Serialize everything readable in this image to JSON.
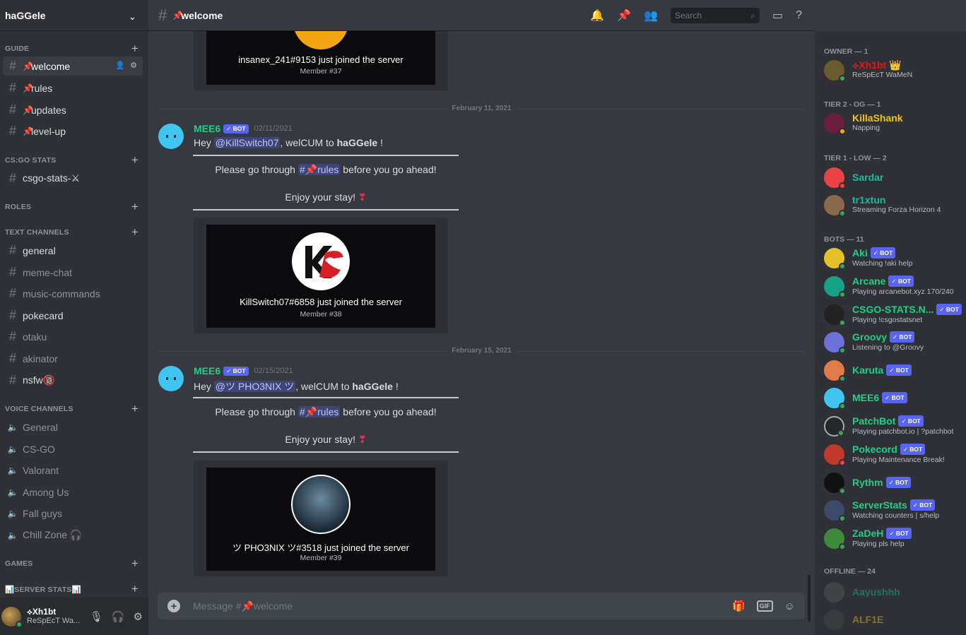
{
  "server": {
    "name": "haGGele"
  },
  "categories": [
    {
      "label": "GUIDE"
    },
    {
      "label": "CS:GO STATS"
    },
    {
      "label": "ROLES"
    },
    {
      "label": "TEXT CHANNELS"
    },
    {
      "label": "VOICE CHANNELS"
    },
    {
      "label": "GAMES"
    },
    {
      "label": "📊SERVER STATS📊"
    }
  ],
  "channels": {
    "welcome": "welcome",
    "rules": "rules",
    "updates": "updates",
    "level_up": "level-up",
    "csgo_stats": "csgo-stats-⚔",
    "general": "general",
    "meme_chat": "meme-chat",
    "music_commands": "music-commands",
    "pokecard": "pokecard",
    "otaku": "otaku",
    "akinator": "akinator",
    "nsfw": "nsfw🔞"
  },
  "voice": [
    "General",
    "CS-GO",
    "Valorant",
    "Among Us",
    "Fall guys",
    "Chill Zone 🎧"
  ],
  "user": {
    "name": "⟡Xh1bt",
    "status": "ReSpEcT Wa..."
  },
  "header": {
    "channel": "welcome",
    "search_placeholder": "Search"
  },
  "messages": [
    {
      "top_card": {
        "text": "insanex_241#9153 just joined the server",
        "member": "Member #37"
      },
      "date": "February 11, 2021",
      "author": "MEE6",
      "badge": "✓ BOT",
      "time": "02/11/2021",
      "pre": "Hey ",
      "mention": "@KillSwitch07",
      "mid": ", welCUM to ",
      "server": "haGGele",
      "end": " !",
      "line1_pre": "Please go through ",
      "line1_chan": "#📌rules",
      "line1_post": "  before you go ahead!",
      "line2": "Enjoy your stay! ",
      "card_text": "KillSwitch07#6858 just joined the server",
      "card_member": "Member #38"
    },
    {
      "date": "February 15, 2021",
      "author": "MEE6",
      "badge": "✓ BOT",
      "time": "02/15/2021",
      "pre": "Hey ",
      "mention": "@ツ PHO3NIX ツ",
      "mid": ", welCUM to ",
      "server": "haGGele",
      "end": " !",
      "line1_pre": "Please go through ",
      "line1_chan": "#📌rules",
      "line1_post": "  before you go ahead!",
      "line2": "Enjoy your stay! ",
      "card_text": "ツ PHO3NIX ツ#3518 just joined the server",
      "card_member": "Member #39"
    }
  ],
  "composer": {
    "placeholder": "Message #📌welcome",
    "gif": "GIF"
  },
  "member_list": {
    "roles": [
      "OWNER — 1",
      "TIER 2 - OG — 1",
      "TIER 1 - LOW — 2",
      "BOTS — 11",
      "OFFLINE — 24"
    ],
    "members": [
      {
        "name": "⟡Xh1bt 👑",
        "status": "ReSpEcT WaMeN",
        "color": "#e01a1a"
      },
      {
        "name": "KillaShank",
        "status": "Napping",
        "color": "#f1c40f"
      },
      {
        "name": "Sardar",
        "status": "",
        "color": "#1abc9c"
      },
      {
        "name": "tr1xtun",
        "status": "Streaming Forza Horizon 4",
        "color": "#1abc9c"
      },
      {
        "name": "Aki",
        "status": "Watching !aki help",
        "color": "#1fcf86"
      },
      {
        "name": "Arcane",
        "status": "Playing arcanebot.xyz 170/240",
        "color": "#1fcf86"
      },
      {
        "name": "CSGO-STATS.N...",
        "status": "Playing !csgostatsnet",
        "color": "#1fcf86"
      },
      {
        "name": "Groovy",
        "status": "Listening to @Groovy",
        "color": "#1fcf86"
      },
      {
        "name": "Karuta",
        "status": "",
        "color": "#1fcf86"
      },
      {
        "name": "MEE6",
        "status": "",
        "color": "#1fcf86"
      },
      {
        "name": "PatchBot",
        "status": "Playing patchbot.io | ?patchbot",
        "color": "#1fcf86"
      },
      {
        "name": "Pokecord",
        "status": "Playing Maintenance Break!",
        "color": "#1fcf86"
      },
      {
        "name": "Rythm",
        "status": "",
        "color": "#1fcf86"
      },
      {
        "name": "ServerStats",
        "status": "Watching counters | s/help",
        "color": "#1fcf86"
      },
      {
        "name": "ZaDeH",
        "status": "Playing pls help",
        "color": "#1fcf86"
      },
      {
        "name": "Aayushhh",
        "status": "",
        "color": "#1abc9c"
      },
      {
        "name": "ALF1E",
        "status": "",
        "color": "#f1c40f"
      }
    ],
    "bot_badge": "✓ BOT"
  }
}
